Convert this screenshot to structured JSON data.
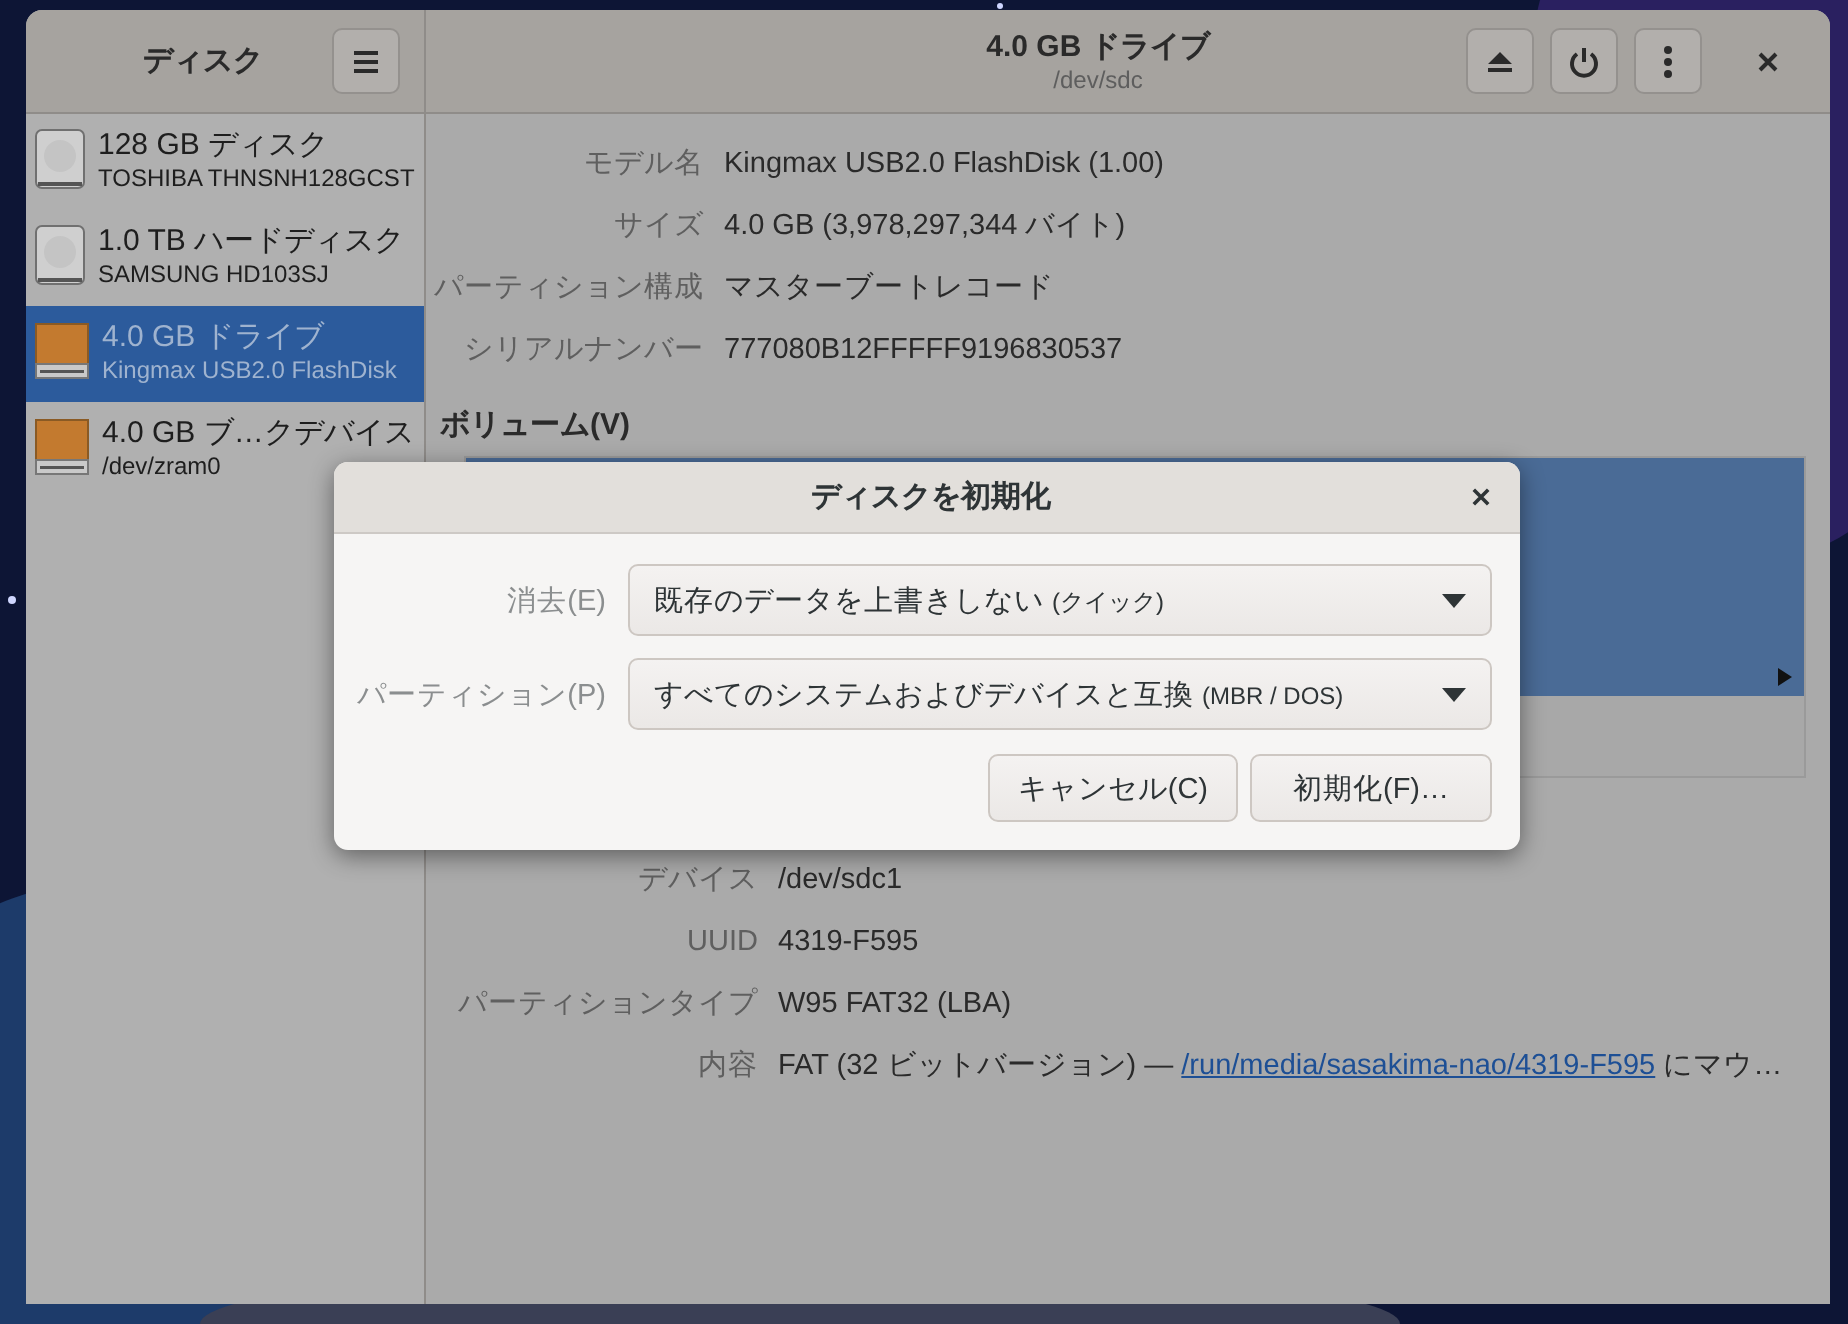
{
  "sidebar": {
    "title": "ディスク",
    "items": [
      {
        "name": "128 GB ディスク",
        "detail": "TOSHIBA THNSNH128GCST",
        "kind": "hdd",
        "selected": false
      },
      {
        "name": "1.0 TB ハードディスク",
        "detail": "SAMSUNG HD103SJ",
        "kind": "hdd",
        "selected": false
      },
      {
        "name": "4.0 GB ドライブ",
        "detail": "Kingmax USB2.0 FlashDisk",
        "kind": "flash",
        "selected": true
      },
      {
        "name": "4.0 GB ブ…クデバイス",
        "detail": "/dev/zram0",
        "kind": "flash",
        "selected": false
      }
    ]
  },
  "header": {
    "title": "4.0 GB ドライブ",
    "subtitle": "/dev/sdc"
  },
  "drive_info": [
    {
      "label": "モデル名",
      "value": "Kingmax USB2.0 FlashDisk (1.00)"
    },
    {
      "label": "サイズ",
      "value": "4.0 GB (3,978,297,344 バイト)"
    },
    {
      "label": "パーティション構成",
      "value": "マスターブートレコード"
    },
    {
      "label": "シリアルナンバー",
      "value": "777080B12FFFFF9196830537"
    }
  ],
  "volumes": {
    "title": "ボリューム(V)",
    "details": [
      {
        "label": "デバイス",
        "value": "/dev/sdc1"
      },
      {
        "label": "UUID",
        "value": "4319-F595"
      },
      {
        "label": "パーティションタイプ",
        "value": "W95 FAT32 (LBA)"
      },
      {
        "label": "内容",
        "value": "FAT (32 ビットバージョン) — ",
        "link": "/run/media/sasakima-nao/4319-F595",
        "suffix": " にマウ…"
      }
    ]
  },
  "dialog": {
    "title": "ディスクを初期化",
    "fields": [
      {
        "label": "消去(E)",
        "value": "既存のデータを上書きしない",
        "hint": "(クイック)"
      },
      {
        "label": "パーティション(P)",
        "value": "すべてのシステムおよびデバイスと互換",
        "hint": "(MBR / DOS)"
      }
    ],
    "buttons": [
      "キャンセル(C)",
      "初期化(F)…"
    ]
  }
}
